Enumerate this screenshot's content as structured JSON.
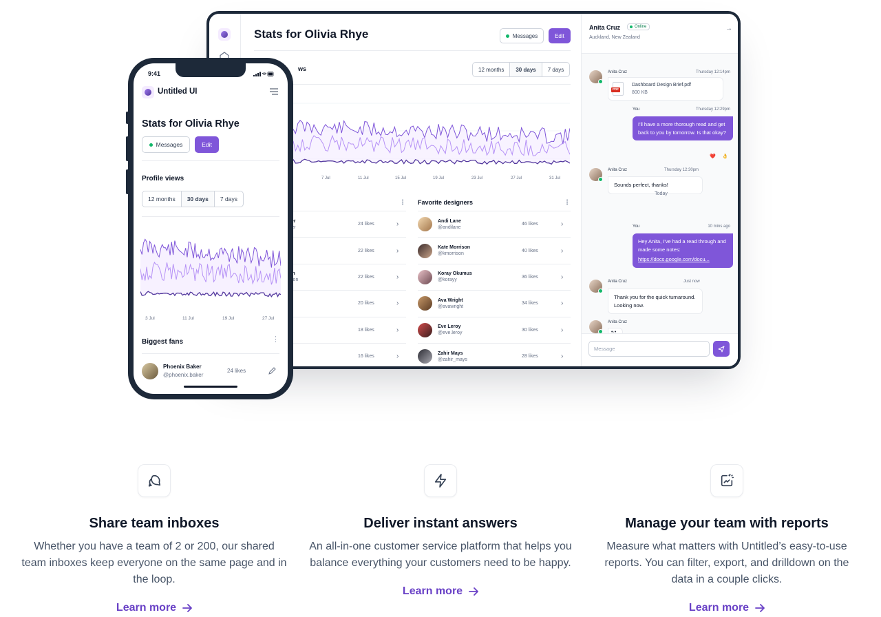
{
  "tablet": {
    "title": "Stats for Olivia Rhye",
    "messages_label": "Messages",
    "edit_label": "Edit",
    "chart_subtitle_fragment": "ws",
    "range_tabs": [
      "12 months",
      "30 days",
      "7 days"
    ],
    "x_ticks": [
      "7 Jul",
      "11 Jul",
      "15 Jul",
      "19 Jul",
      "23 Jul",
      "27 Jul",
      "31 Jul"
    ],
    "fans": {
      "rows": [
        {
          "name": "Baker",
          "handle": ".baker",
          "likes": "24 likes"
        },
        {
          "name": "ner",
          "handle": "ner",
          "likes": "22 likes"
        },
        {
          "name": "inson",
          "handle": "ilkinson",
          "likes": "22 likes"
        },
        {
          "name": "Wu",
          "handle": "wu",
          "likes": "20 likes"
        },
        {
          "name": "ig",
          "handle": "g",
          "likes": "18 likes"
        },
        {
          "name": "no",
          "handle": "",
          "likes": "16 likes"
        }
      ]
    },
    "designers": {
      "title": "Favorite designers",
      "rows": [
        {
          "name": "Andi Lane",
          "handle": "@andilane",
          "likes": "46 likes"
        },
        {
          "name": "Kate Morrison",
          "handle": "@kmorrison",
          "likes": "40 likes"
        },
        {
          "name": "Koray Okumus",
          "handle": "@korayy",
          "likes": "36 likes"
        },
        {
          "name": "Ava Wright",
          "handle": "@avawright",
          "likes": "34 likes"
        },
        {
          "name": "Eve Leroy",
          "handle": "@eve.leroy",
          "likes": "30 likes"
        },
        {
          "name": "Zahir Mays",
          "handle": "@zahir_mays",
          "likes": "28 likes"
        }
      ]
    },
    "chat": {
      "name": "Anita Cruz",
      "status": "Online",
      "location": "Auckland, New Zealand",
      "messages": [
        {
          "sender": "Anita Cruz",
          "time": "Thursday 12:14pm",
          "file_name": "Dashboard Design Brief.pdf",
          "file_size": "800 KB",
          "file_badge": "PDF"
        },
        {
          "sender": "You",
          "time": "Thursday 12:29pm",
          "text": "I'll have a more thorough read and get back to you by tomorrow. Is that okay?"
        },
        {
          "sender": "Anita Cruz",
          "time": "Thursday 12:30pm",
          "text": "Sounds perfect, thanks!"
        },
        {
          "sender": "You",
          "time": "10 mins ago",
          "text": "Hey Anita, I've had a read through and made some notes:",
          "link": "https://docs.google.com/docu..."
        },
        {
          "sender": "Anita Cruz",
          "time": "Just now",
          "text": "Thank you for the quick turnaround. Looking now."
        },
        {
          "sender": "Anita Cruz",
          "typing": "•·•"
        }
      ],
      "reactions": [
        "❤️",
        "👌"
      ],
      "today_label": "Today",
      "input_placeholder": "Message"
    }
  },
  "phone": {
    "time": "9:41",
    "brand": "Untitled UI",
    "title": "Stats for Olivia Rhye",
    "messages_label": "Messages",
    "edit_label": "Edit",
    "section_title": "Profile views",
    "range_tabs": [
      "12 months",
      "30 days",
      "7 days"
    ],
    "x_ticks": [
      "3 Jul",
      "11 Jul",
      "19 Jul",
      "27 Jul"
    ],
    "fans_title": "Biggest fans",
    "fan": {
      "name": "Phoenix Baker",
      "handle": "@phoenix.baker",
      "likes": "24 likes"
    }
  },
  "features": [
    {
      "icon": "message-chat-icon",
      "title": "Share team inboxes",
      "desc": "Whether you have a team of 2 or 200, our shared team inboxes keep everyone on the same page and in the loop.",
      "link": "Learn more"
    },
    {
      "icon": "lightning-icon",
      "title": "Deliver instant answers",
      "desc": "An all-in-one customer service platform that helps you balance everything your customers need to be happy.",
      "link": "Learn more"
    },
    {
      "icon": "chart-report-icon",
      "title": "Manage your team with reports",
      "desc": "Measure what matters with Untitled’s easy-to-use reports. You can filter, export, and drilldown on the data in a couple clicks.",
      "link": "Learn more"
    }
  ],
  "colors": {
    "accent": "#7f56d9",
    "link": "#6941c6",
    "online": "#12b76a"
  }
}
